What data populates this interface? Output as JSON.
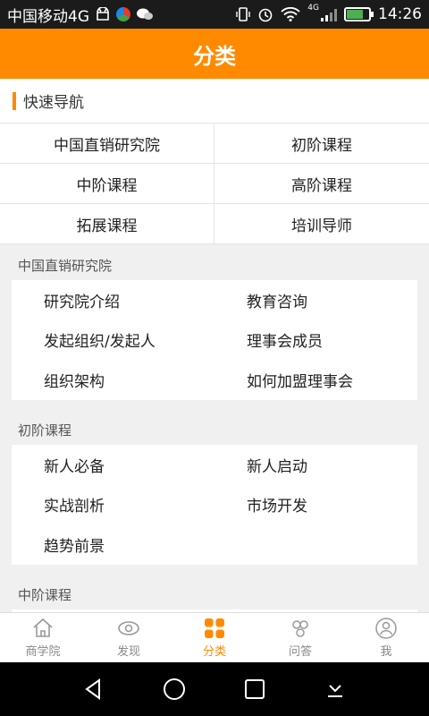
{
  "status": {
    "carrier": "中国移动4G",
    "network_badge": "4G",
    "time": "14:26"
  },
  "header": {
    "title": "分类"
  },
  "quicknav": {
    "title": "快速导航",
    "items": [
      "中国直销研究院",
      "初阶课程",
      "中阶课程",
      "高阶课程",
      "拓展课程",
      "培训导师"
    ]
  },
  "sections": [
    {
      "title": "中国直销研究院",
      "items": [
        "研究院介绍",
        "教育咨询",
        "发起组织/发起人",
        "理事会成员",
        "组织架构",
        "如何加盟理事会"
      ]
    },
    {
      "title": "初阶课程",
      "items": [
        "新人必备",
        "新人启动",
        "实战剖析",
        "市场开发",
        "趋势前景"
      ]
    },
    {
      "title": "中阶课程",
      "items": []
    }
  ],
  "tabs": [
    {
      "label": "商学院",
      "icon": "home-icon"
    },
    {
      "label": "发现",
      "icon": "eye-icon"
    },
    {
      "label": "分类",
      "icon": "grid-icon",
      "active": true
    },
    {
      "label": "问答",
      "icon": "people-icon"
    },
    {
      "label": "我",
      "icon": "user-icon"
    }
  ],
  "colors": {
    "accent": "#ff8a00",
    "statusbar": "#1b1b1b",
    "background": "#f0f0f0"
  }
}
